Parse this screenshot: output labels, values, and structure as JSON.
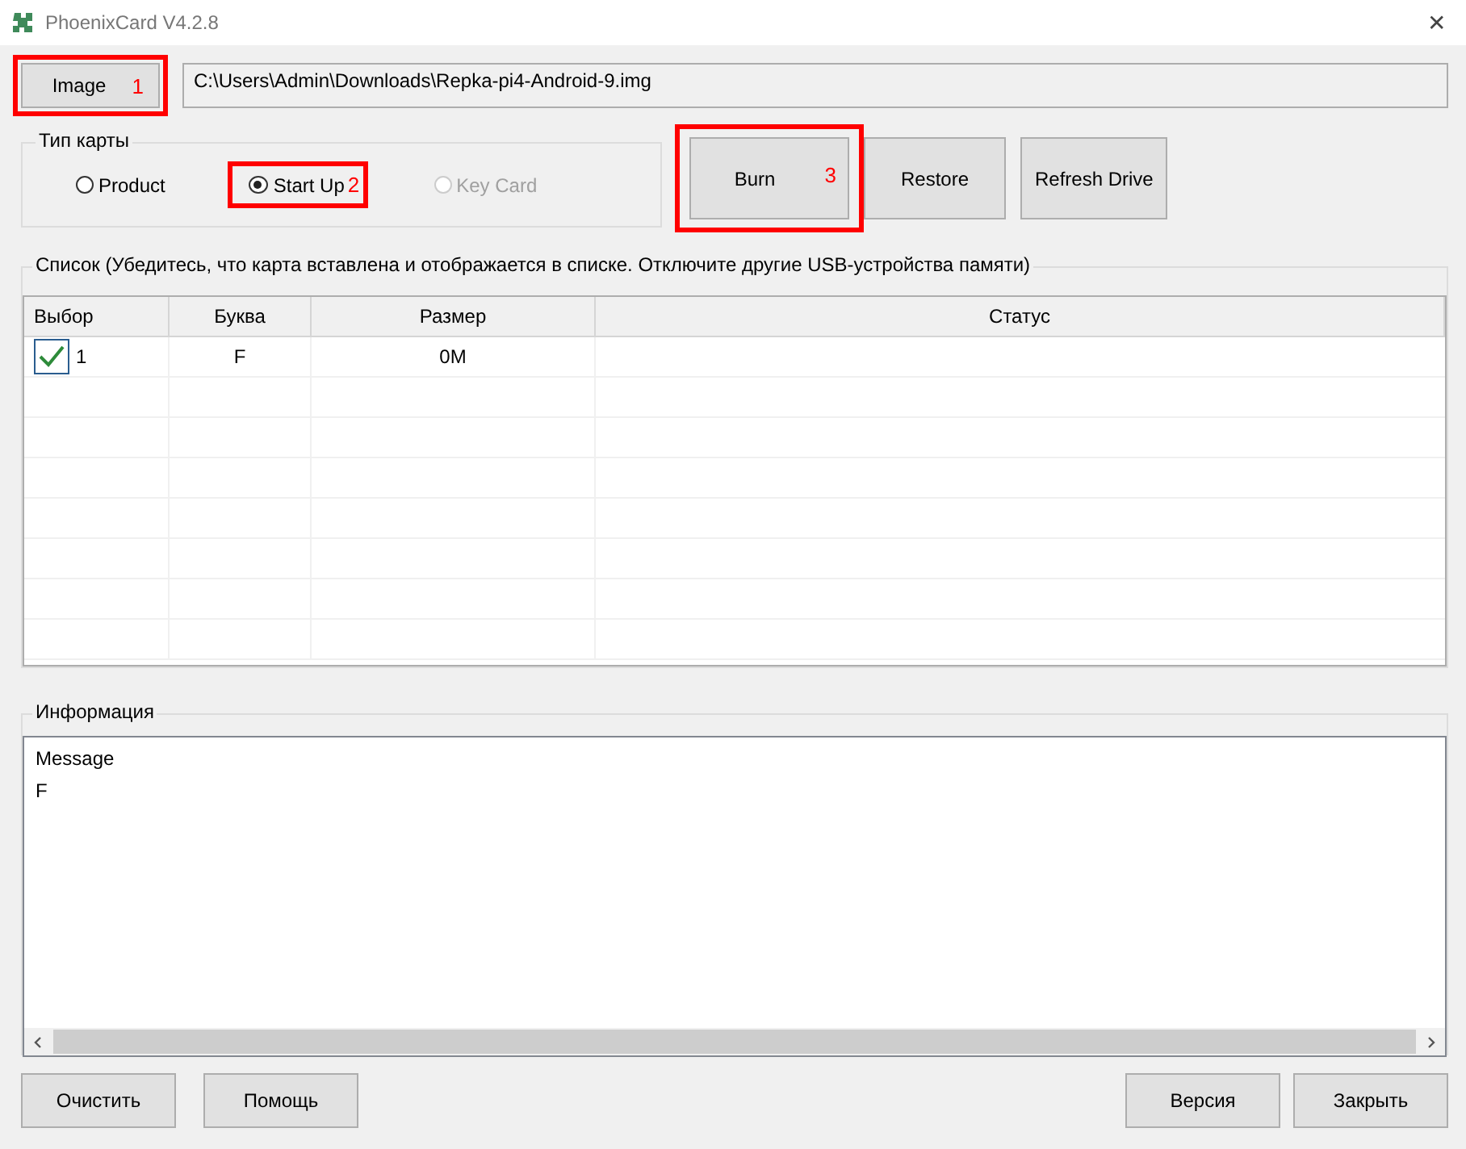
{
  "window": {
    "title": "PhoenixCard V4.2.8",
    "close": "✕"
  },
  "image_button": {
    "label": "Image",
    "marker": "1",
    "highlighted": true
  },
  "image_path": {
    "value": "C:\\Users\\Admin\\Downloads\\Repka-pi4-Android-9.img"
  },
  "card_type": {
    "title": "Тип карты",
    "options": [
      {
        "label": "Product",
        "selected": false,
        "disabled": false
      },
      {
        "label": "Start Up",
        "selected": true,
        "disabled": false,
        "marker": "2",
        "highlighted": true
      },
      {
        "label": "Key Card",
        "selected": false,
        "disabled": true
      }
    ]
  },
  "actions": [
    {
      "label": "Burn",
      "marker": "3",
      "highlighted": true
    },
    {
      "label": "Restore",
      "highlighted": false
    },
    {
      "label": "Refresh Drive",
      "highlighted": false
    }
  ],
  "list": {
    "title": "Список (Убедитесь, что карта вставлена и отображается в списке. Отключите другие USB-устройства памяти)",
    "columns": [
      "Выбор",
      "Буква",
      "Размер",
      "Статус"
    ],
    "rows": [
      {
        "checked": true,
        "index": "1",
        "letter": "F",
        "size": "0M",
        "status": ""
      }
    ]
  },
  "info": {
    "title": "Информация",
    "lines": [
      "Message",
      "F"
    ]
  },
  "buttons_left": [
    "Очистить",
    "Помощь"
  ],
  "buttons_right": [
    "Версия",
    "Закрыть"
  ]
}
